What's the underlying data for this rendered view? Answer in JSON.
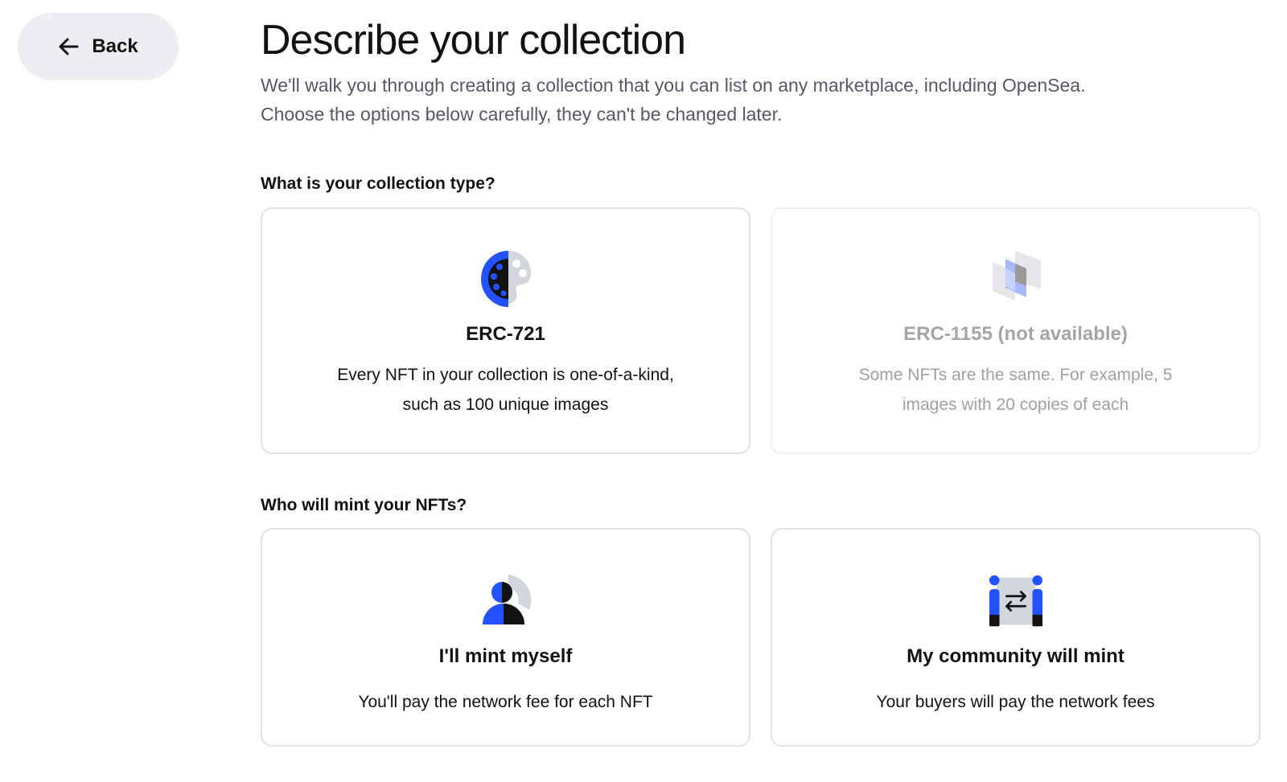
{
  "nav": {
    "back_label": "Back",
    "back_icon": "arrow-left-icon"
  },
  "header": {
    "title": "Describe your collection",
    "subtitle_line1": "We'll walk you through creating a collection that you can list on any marketplace, including OpenSea.",
    "subtitle_line2": "Choose the options below carefully, they can't be changed later."
  },
  "collection_type": {
    "question": "What is your collection type?",
    "options": [
      {
        "title": "ERC-721",
        "description": "Every NFT in your collection is one-of-a-kind, such as 100 unique images",
        "icon": "palette-icon",
        "available": true
      },
      {
        "title": "ERC-1155 (not available)",
        "description": "Some NFTs are the same. For example, 5 images with 20 copies of each",
        "icon": "stacked-layers-icon",
        "available": false
      }
    ]
  },
  "minting": {
    "question": "Who will mint your NFTs?",
    "options": [
      {
        "title": "I'll mint myself",
        "description": "You'll pay the network fee for each NFT",
        "icon": "person-icon"
      },
      {
        "title": "My community will mint",
        "description": "Your buyers will pay the network fees",
        "icon": "community-exchange-icon"
      }
    ]
  },
  "colors": {
    "accent_blue": "#2252ff",
    "icon_gray": "#d3d6dc",
    "back_bg": "#eceef1",
    "subtitle_text": "#545867",
    "disabled_text": "#a5a5a5"
  }
}
